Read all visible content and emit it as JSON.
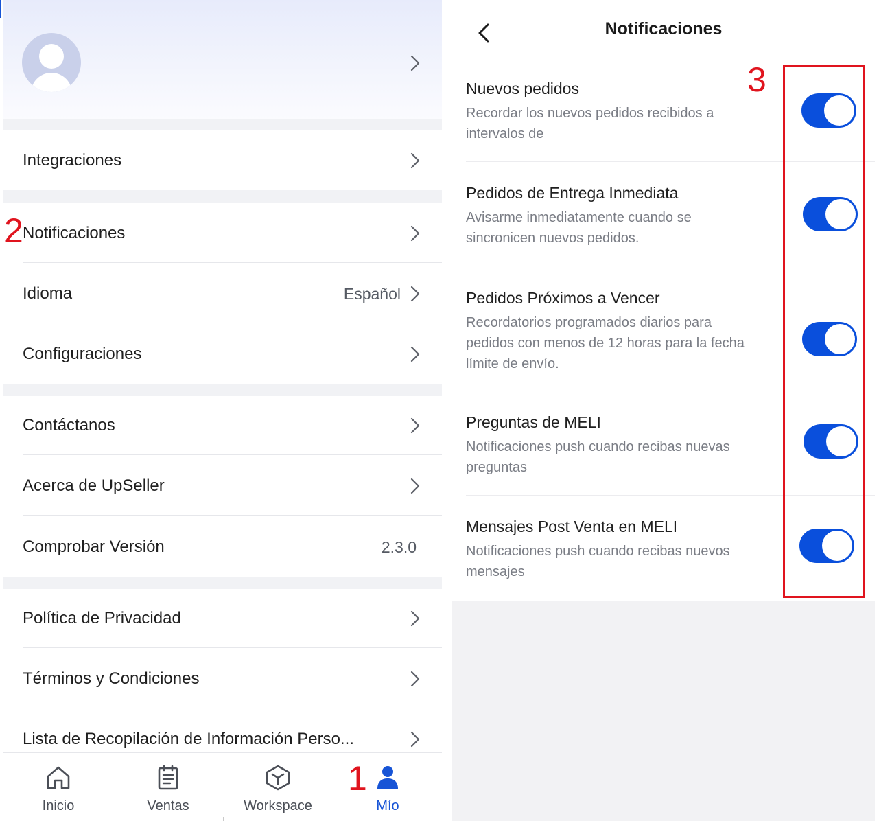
{
  "left": {
    "menu": {
      "integrations": "Integraciones",
      "notifications": "Notificaciones",
      "language": "Idioma",
      "language_value": "Español",
      "settings": "Configuraciones",
      "contact": "Contáctanos",
      "about": "Acerca de UpSeller",
      "check_version": "Comprobar Versión",
      "version_value": "2.3.0",
      "privacy": "Política de Privacidad",
      "terms": "Términos y Condiciones",
      "personal_info": "Lista de Recopilación de Información Perso..."
    },
    "nav": {
      "home": "Inicio",
      "sales": "Ventas",
      "workspace": "Workspace",
      "mine": "Mío"
    }
  },
  "right": {
    "title": "Notificaciones",
    "items": [
      {
        "title": "Nuevos  pedidos",
        "desc": "Recordar los nuevos pedidos recibidos a\nintervalos de",
        "enabled": true
      },
      {
        "title": "Pedidos de Entrega Inmediata",
        "desc": "Avisarme inmediatamente cuando se\nsincronicen nuevos pedidos.",
        "enabled": true
      },
      {
        "title": "Pedidos Próximos a Vencer",
        "desc": "Recordatorios programados diarios para\npedidos con menos de 12 horas para la fecha\nlímite de envío.",
        "enabled": true
      },
      {
        "title": "Preguntas de MELI",
        "desc": "Notificaciones push cuando recibas nuevas\npreguntas",
        "enabled": true
      },
      {
        "title": "Mensajes Post Venta en MELI",
        "desc": "Notificaciones push cuando recibas nuevos\nmensajes",
        "enabled": true
      }
    ]
  },
  "annotations": {
    "step1": "1",
    "step2": "2",
    "step3": "3"
  },
  "colors": {
    "accent": "#1754d6",
    "toggle_on": "#0a4fdc",
    "annotation": "#e0141e"
  },
  "icons": [
    "avatar",
    "chevron-right-icon",
    "back-arrow-icon",
    "home-icon",
    "clipboard-icon",
    "cube-icon",
    "person-icon"
  ]
}
